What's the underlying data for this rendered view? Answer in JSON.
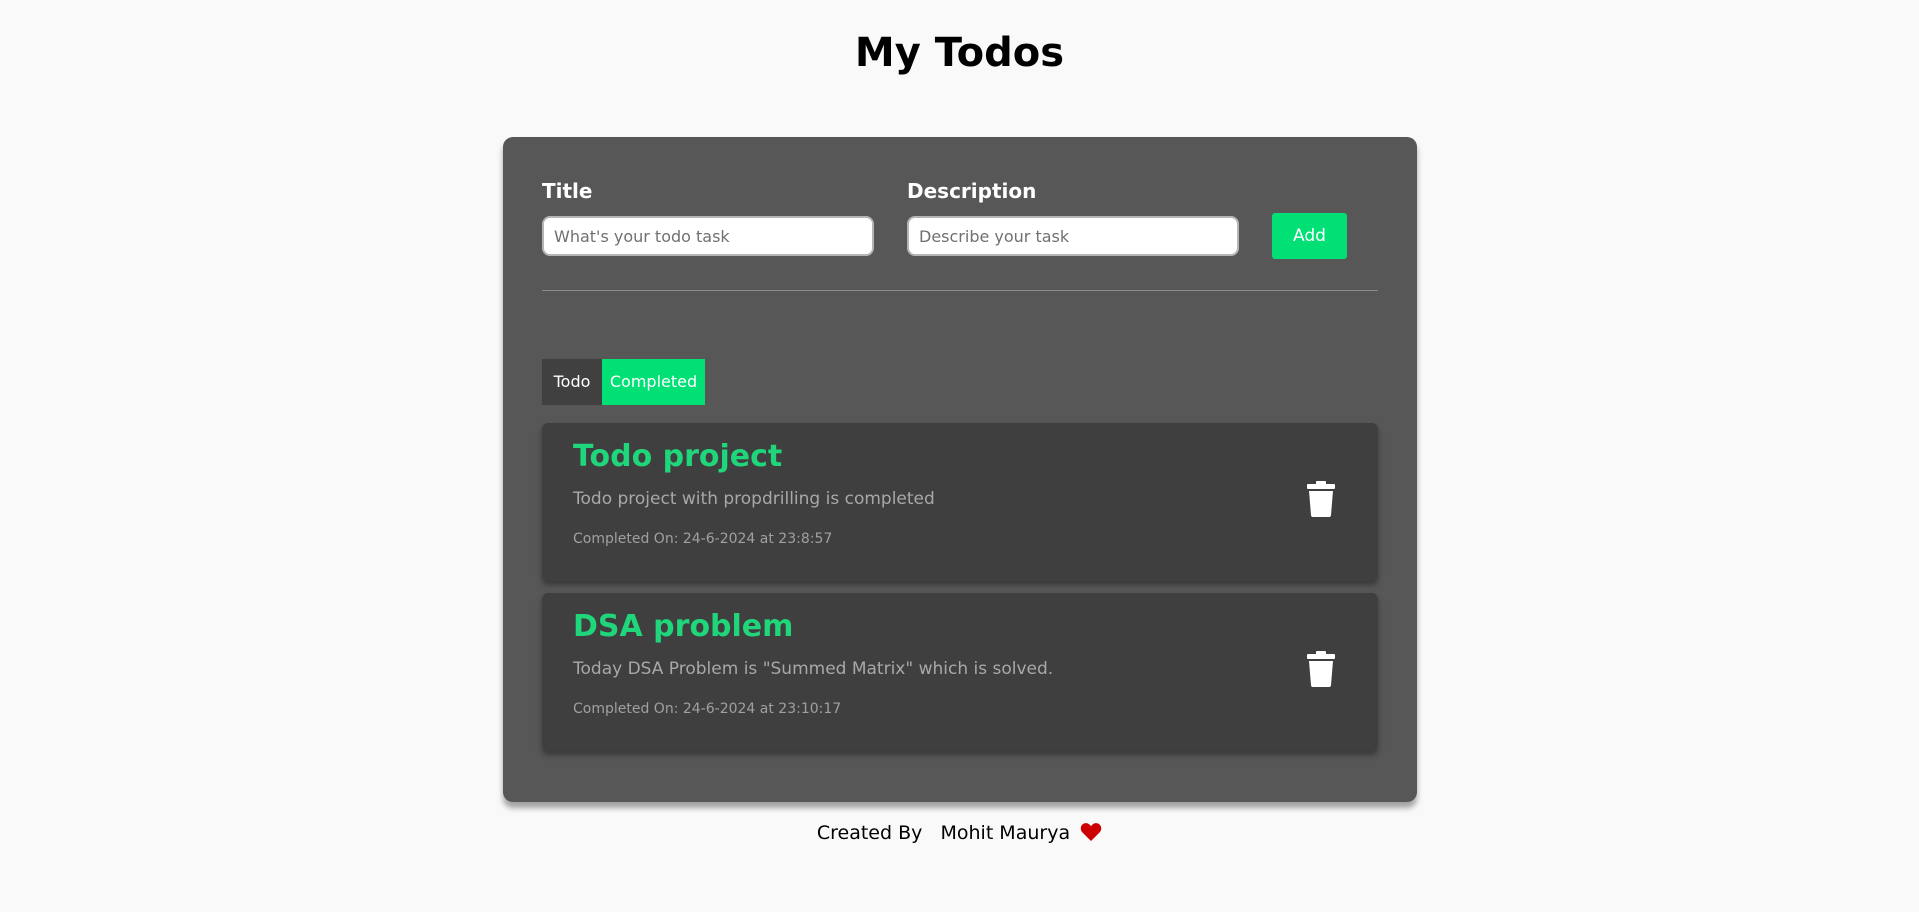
{
  "header": {
    "title": "My Todos"
  },
  "form": {
    "title_label": "Title",
    "title_value": "",
    "title_placeholder": "What's your todo task",
    "description_label": "Description",
    "description_value": "",
    "description_placeholder": "Describe your task",
    "add_label": "Add"
  },
  "tabs": [
    {
      "label": "Todo",
      "active": false
    },
    {
      "label": "Completed",
      "active": true
    }
  ],
  "todos": [
    {
      "title": "Todo project",
      "description": "Todo project with propdrilling is completed",
      "completed_on": "Completed On: 24-6-2024 at 23:8:57",
      "delete_icon": "trash-icon"
    },
    {
      "title": "DSA problem",
      "description": "Today DSA Problem is \"Summed Matrix\" which is solved.",
      "completed_on": "Completed On: 24-6-2024 at 23:10:17",
      "delete_icon": "trash-icon"
    }
  ],
  "footer": {
    "created_by": "Created By",
    "author": "Mohit Maurya",
    "heart_icon": "heart-icon"
  },
  "colors": {
    "accent": "#00e075",
    "panel": "#575757",
    "card": "#3f3f3f",
    "heart": "#cc0000"
  }
}
